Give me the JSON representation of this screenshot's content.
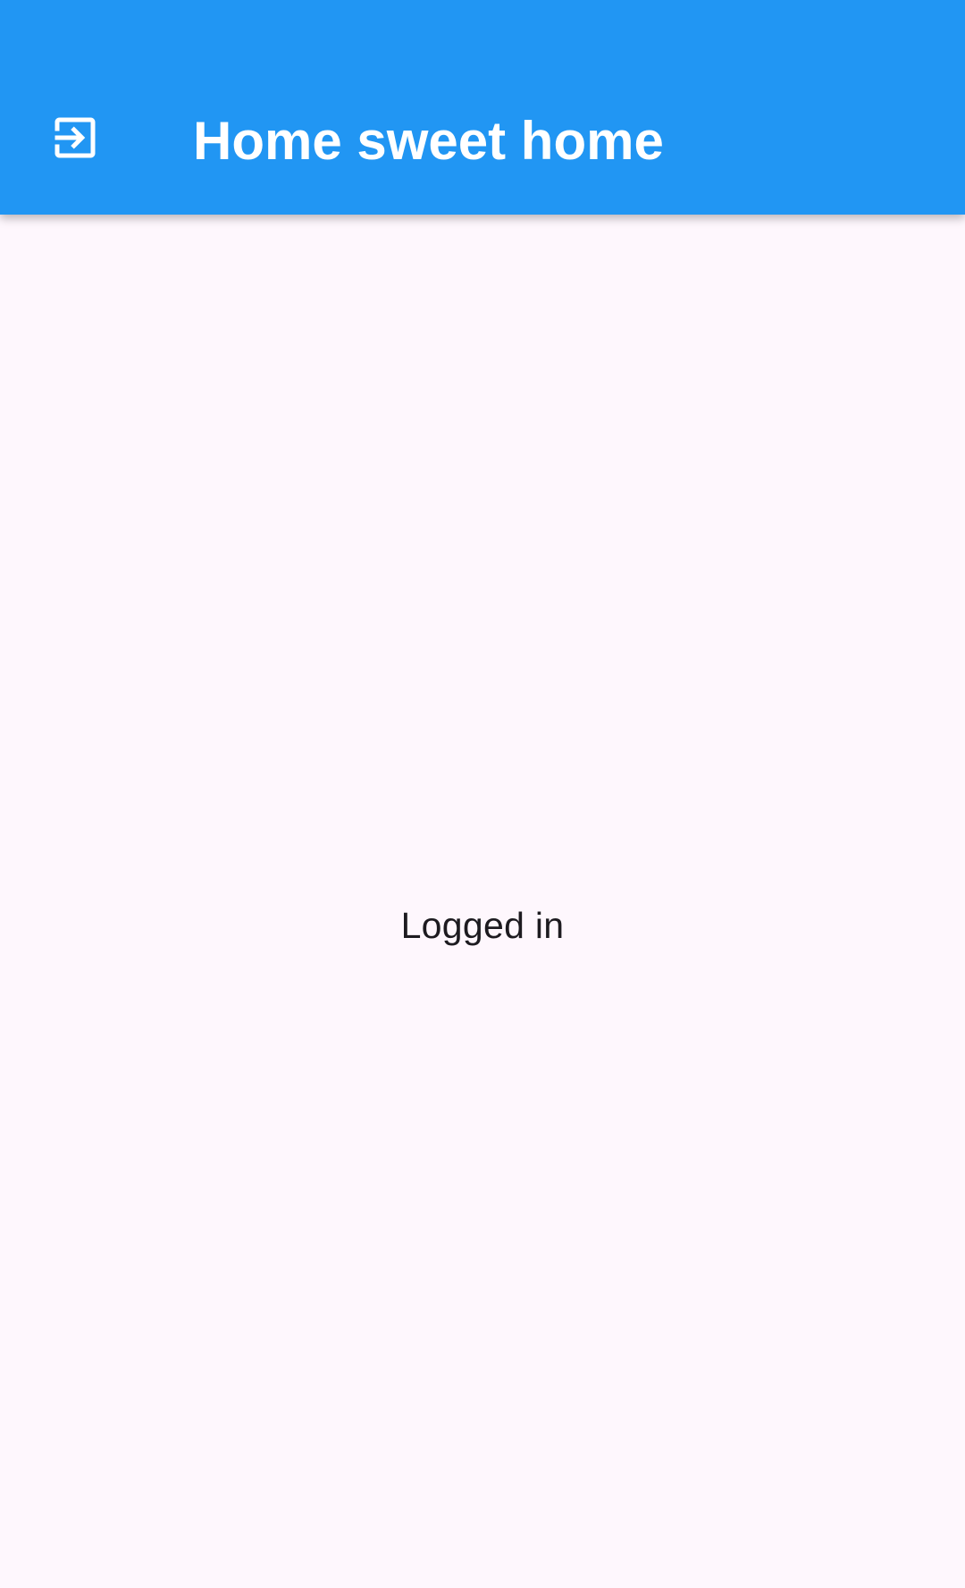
{
  "app_bar": {
    "title": "Home sweet home",
    "leading_icon": "exit-to-app-icon",
    "background_color": "#2196f3",
    "foreground_color": "#ffffff"
  },
  "body": {
    "status_text": "Logged in",
    "background_color": "#fef7fd",
    "text_color": "#1d1b20"
  }
}
